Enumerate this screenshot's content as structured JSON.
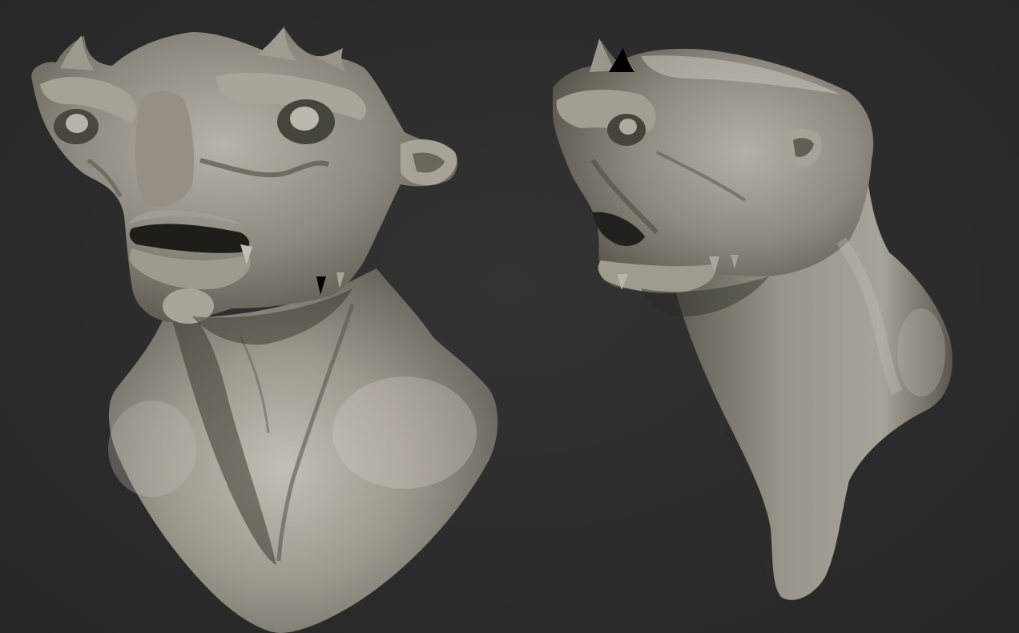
{
  "scene": {
    "background_color": "#2c2c2d",
    "clay_color": "#8a8579",
    "clay_highlight": "#c9c5bb",
    "clay_shadow": "#3e3b35",
    "objects": [
      {
        "name": "creature-bust-front-three-quarter"
      },
      {
        "name": "creature-bust-side-profile"
      }
    ]
  }
}
